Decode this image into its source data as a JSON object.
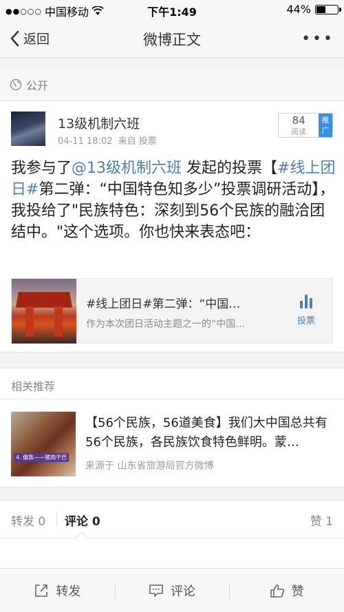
{
  "status_bar": {
    "carrier": "中国移动",
    "time": "下午1:49",
    "battery": "44%",
    "battery_level": 0.44
  },
  "nav": {
    "back_label": "返回",
    "title": "微博正文",
    "more_label": "•••"
  },
  "visibility": {
    "label": "公开"
  },
  "post": {
    "author": "13级机制六班",
    "timestamp": "04-11 18:02",
    "source_prefix": "来自",
    "source": "投票",
    "read_count": "84",
    "read_label": "阅读",
    "promote_label": "推广",
    "text_before": "我参与了",
    "mention": "@13级机制六班",
    "text_middle": " 发起的投票【",
    "hashtag": "#线上团日#",
    "text_after": "第二弹：“中国特色知多少”投票调研活动】，我投给了\"民族特色：深刻到56个民族的融洽团结中。\"这个选项。你也快来表态吧：",
    "vote_card": {
      "title": "#线上团日#第二弹：“中国…",
      "description": "作为本次团日活动主题之一的“中国…",
      "action_label": "投票"
    }
  },
  "related": {
    "header": "相关推荐",
    "item": {
      "text": "【56个民族，56道美食】我们大中国总共有56个民族，各民族饮食特色鲜明。蒙…",
      "source": "来源于 山东省旅游局官方微博",
      "thumb_label": "4. 傣族——猪肉干巴"
    }
  },
  "stats": {
    "repost": "转发 0",
    "comment": "评论 0",
    "like": "赞 1"
  },
  "toolbar": {
    "repost": "转发",
    "comment": "评论",
    "like": "赞"
  }
}
